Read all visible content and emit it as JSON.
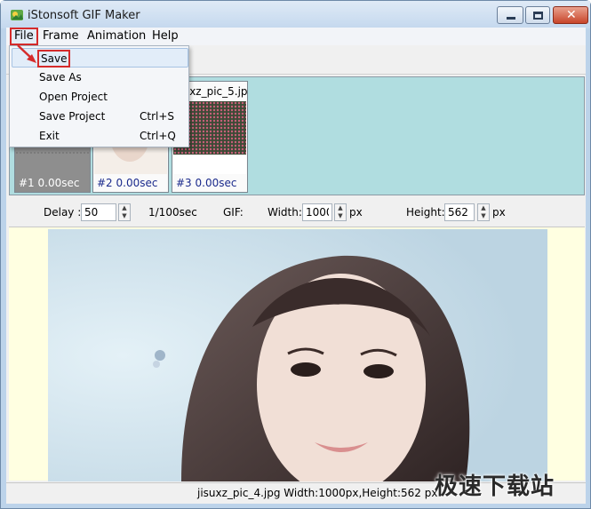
{
  "window": {
    "title": "iStonsoft GIF Maker"
  },
  "menu": {
    "items": [
      "File",
      "Frame",
      "Animation",
      "Help"
    ],
    "file_dropdown": [
      {
        "label": "Save",
        "shortcut": ""
      },
      {
        "label": "Save As",
        "shortcut": ""
      },
      {
        "label": "Open Project",
        "shortcut": ""
      },
      {
        "label": "Save Project",
        "shortcut": "Ctrl+S"
      },
      {
        "label": "Exit",
        "shortcut": "Ctrl+Q"
      }
    ]
  },
  "frames": [
    {
      "name": "",
      "caption": "#1  0.00sec",
      "selected": true
    },
    {
      "name": "",
      "caption": "#2  0.00sec",
      "selected": false
    },
    {
      "name": "isuxz_pic_5.jp",
      "caption": "#3  0.00sec",
      "selected": false
    }
  ],
  "properties": {
    "delay_label": "Delay :",
    "delay_value": "50",
    "delay_unit": "1/100sec",
    "gif_label": "GIF:",
    "width_label": "Width:",
    "width_value": "1000",
    "width_unit": "px",
    "height_label": "Height:",
    "height_value": "562",
    "height_unit": "px"
  },
  "status": {
    "text": "jisuxz_pic_4.jpg Width:1000px,Height:562 px"
  },
  "watermark": "极速下载站",
  "colors": {
    "highlight": "#d52b2b",
    "strip_bg": "#b0dde0",
    "canvas_bg": "#ffffe1",
    "caption": "#1a2a8c"
  }
}
